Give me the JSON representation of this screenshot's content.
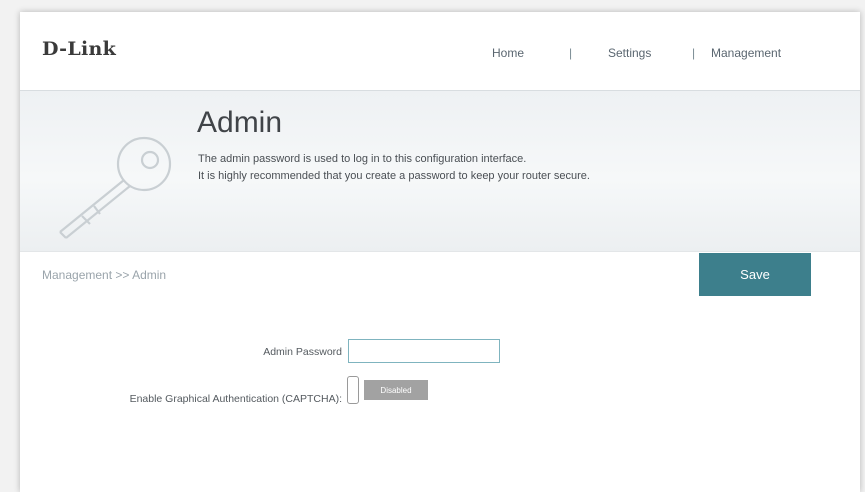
{
  "header": {
    "logo": "D-Link",
    "nav": {
      "home": "Home",
      "separator": "|",
      "settings": "Settings",
      "management": "Management"
    }
  },
  "banner": {
    "title": "Admin",
    "line1": "The admin password is used to log in to this configuration interface.",
    "line2": "It is highly recommended that you create a password to keep your router secure.",
    "icon": "key-icon"
  },
  "breadcrumb": "Management >> Admin",
  "save_label": "Save",
  "form": {
    "password_label": "Admin Password",
    "password_value": "",
    "captcha_label": "Enable Graphical Authentication (CAPTCHA):",
    "captcha_state": "Disabled"
  },
  "colors": {
    "accent": "#3d7f8c",
    "toggle_off": "#a2a2a2",
    "input_border": "#7fb4bf"
  }
}
